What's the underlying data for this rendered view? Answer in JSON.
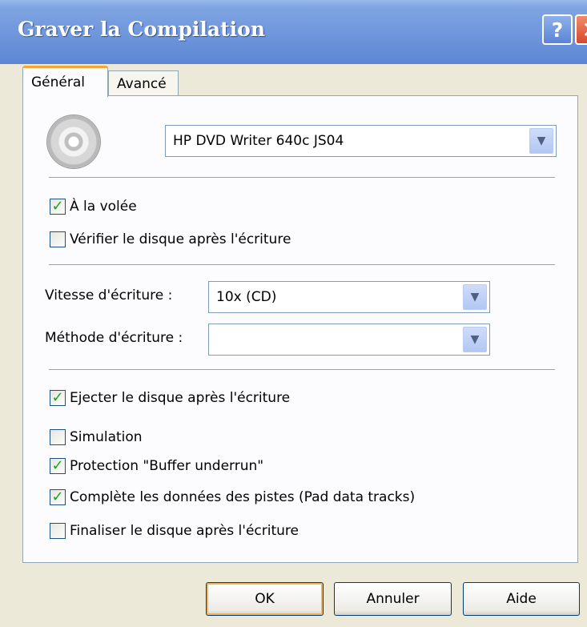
{
  "window": {
    "title": "Graver la Compilation",
    "help_label": "?",
    "close_label": "✕"
  },
  "tabs": [
    {
      "label": "Général",
      "active": true
    },
    {
      "label": "Avancé",
      "active": false
    }
  ],
  "drive": {
    "icon": "cd-icon",
    "selected": "HP DVD Writer 640c JS04"
  },
  "options_top": [
    {
      "label": "À la volée",
      "checked": true
    },
    {
      "label": "Vérifier le disque après l'écriture",
      "checked": false
    }
  ],
  "speed": {
    "label": "Vitesse d'écriture :",
    "selected": "10x (CD)"
  },
  "method": {
    "label": "Méthode d'écriture :",
    "selected": ""
  },
  "options_bottom": [
    {
      "label": "Ejecter le disque après l'écriture",
      "checked": true
    },
    {
      "label": "Simulation",
      "checked": false
    },
    {
      "label": "Protection \"Buffer underrun\"",
      "checked": true
    },
    {
      "label": "Complète les données des pistes (Pad data tracks)",
      "checked": true
    },
    {
      "label": "Finaliser le disque après l'écriture",
      "checked": false
    }
  ],
  "buttons": {
    "ok": "OK",
    "cancel": "Annuler",
    "help": "Aide"
  }
}
